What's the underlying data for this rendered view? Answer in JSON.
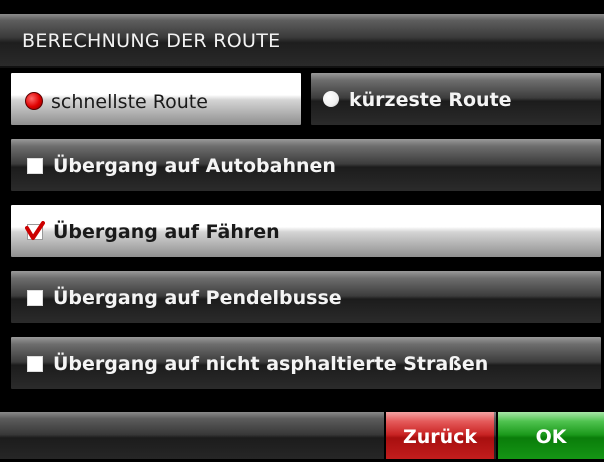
{
  "header": {
    "title": "BERECHNUNG DER ROUTE"
  },
  "route_type": {
    "options": [
      {
        "label": "schnellste Route",
        "selected": true
      },
      {
        "label": "kürzeste Route",
        "selected": false
      }
    ]
  },
  "options": [
    {
      "label": "Übergang auf Autobahnen",
      "checked": false
    },
    {
      "label": "Übergang auf Fähren",
      "checked": true
    },
    {
      "label": "Übergang auf Pendelbusse",
      "checked": false
    },
    {
      "label": "Übergang auf nicht asphaltierte Straßen",
      "checked": false
    }
  ],
  "footer": {
    "back_label": "Zurück",
    "ok_label": "OK"
  },
  "colors": {
    "accent_red": "#c92424",
    "accent_green": "#1c9a1c",
    "selected_bg": "#ffffff"
  },
  "icons": {
    "radio": "radio-button-icon",
    "checkbox": "checkbox-icon",
    "check": "checkmark-icon"
  }
}
